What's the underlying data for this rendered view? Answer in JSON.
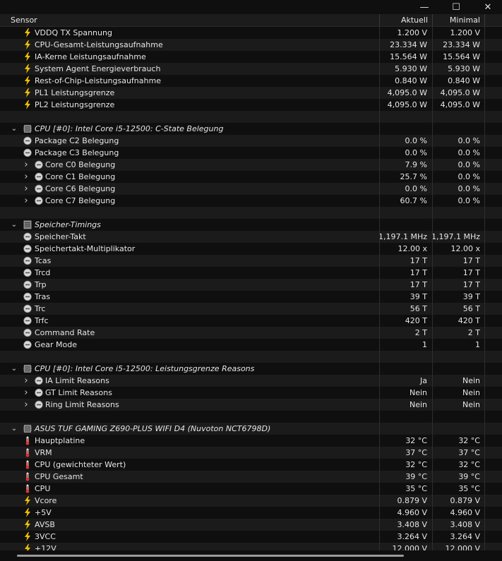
{
  "header": {
    "sensor": "Sensor",
    "current": "Aktuell",
    "minimal": "Minimal"
  },
  "window": {
    "minimize": "—",
    "maximize": "☐",
    "close": "✕"
  },
  "rows": [
    {
      "type": "item",
      "indent": 1,
      "icon": "bolt",
      "label": "VDDQ TX Spannung",
      "v1": "1.200 V",
      "v2": "1.200 V"
    },
    {
      "type": "item",
      "indent": 1,
      "icon": "bolt",
      "label": "CPU-Gesamt-Leistungsaufnahme",
      "v1": "23.334 W",
      "v2": "23.334 W"
    },
    {
      "type": "item",
      "indent": 1,
      "icon": "bolt",
      "label": "IA-Kerne Leistungsaufnahme",
      "v1": "15.564 W",
      "v2": "15.564 W"
    },
    {
      "type": "item",
      "indent": 1,
      "icon": "bolt",
      "label": "System Agent Energieverbrauch",
      "v1": "5.930 W",
      "v2": "5.930 W"
    },
    {
      "type": "item",
      "indent": 1,
      "icon": "bolt",
      "label": "Rest-of-Chip-Leistungsaufnahme",
      "v1": "0.840 W",
      "v2": "0.840 W"
    },
    {
      "type": "item",
      "indent": 1,
      "icon": "bolt",
      "label": "PL1 Leistungsgrenze",
      "v1": "4,095.0 W",
      "v2": "4,095.0 W"
    },
    {
      "type": "item",
      "indent": 1,
      "icon": "bolt",
      "label": "PL2 Leistungsgrenze",
      "v1": "4,095.0 W",
      "v2": "4,095.0 W"
    },
    {
      "type": "blank"
    },
    {
      "type": "group",
      "icon": "chip",
      "label": "CPU [#0]: Intel Core i5-12500: C-State Belegung"
    },
    {
      "type": "item",
      "indent": 1,
      "icon": "gauge",
      "label": "Package C2 Belegung",
      "v1": "0.0 %",
      "v2": "0.0 %"
    },
    {
      "type": "item",
      "indent": 1,
      "icon": "gauge",
      "label": "Package C3 Belegung",
      "v1": "0.0 %",
      "v2": "0.0 %"
    },
    {
      "type": "item",
      "indent": 2,
      "expand": true,
      "icon": "gauge",
      "label": "Core C0 Belegung",
      "v1": "7.9 %",
      "v2": "0.0 %"
    },
    {
      "type": "item",
      "indent": 2,
      "expand": true,
      "icon": "gauge",
      "label": "Core C1 Belegung",
      "v1": "25.7 %",
      "v2": "0.0 %"
    },
    {
      "type": "item",
      "indent": 2,
      "expand": true,
      "icon": "gauge",
      "label": "Core C6 Belegung",
      "v1": "0.0 %",
      "v2": "0.0 %"
    },
    {
      "type": "item",
      "indent": 2,
      "expand": true,
      "icon": "gauge",
      "label": "Core C7 Belegung",
      "v1": "60.7 %",
      "v2": "0.0 %"
    },
    {
      "type": "blank"
    },
    {
      "type": "group",
      "icon": "ram",
      "label": "Speicher-Timings"
    },
    {
      "type": "item",
      "indent": 1,
      "icon": "gauge",
      "label": "Speicher-Takt",
      "v1": "1,197.1 MHz",
      "v2": "1,197.1 MHz"
    },
    {
      "type": "item",
      "indent": 1,
      "icon": "gauge",
      "label": "Speichertakt-Multiplikator",
      "v1": "12.00 x",
      "v2": "12.00 x"
    },
    {
      "type": "item",
      "indent": 1,
      "icon": "gauge",
      "label": "Tcas",
      "v1": "17 T",
      "v2": "17 T"
    },
    {
      "type": "item",
      "indent": 1,
      "icon": "gauge",
      "label": "Trcd",
      "v1": "17 T",
      "v2": "17 T"
    },
    {
      "type": "item",
      "indent": 1,
      "icon": "gauge",
      "label": "Trp",
      "v1": "17 T",
      "v2": "17 T"
    },
    {
      "type": "item",
      "indent": 1,
      "icon": "gauge",
      "label": "Tras",
      "v1": "39 T",
      "v2": "39 T"
    },
    {
      "type": "item",
      "indent": 1,
      "icon": "gauge",
      "label": "Trc",
      "v1": "56 T",
      "v2": "56 T"
    },
    {
      "type": "item",
      "indent": 1,
      "icon": "gauge",
      "label": "Trfc",
      "v1": "420 T",
      "v2": "420 T"
    },
    {
      "type": "item",
      "indent": 1,
      "icon": "gauge",
      "label": "Command Rate",
      "v1": "2 T",
      "v2": "2 T"
    },
    {
      "type": "item",
      "indent": 1,
      "icon": "gauge",
      "label": "Gear Mode",
      "v1": "1",
      "v2": "1"
    },
    {
      "type": "blank"
    },
    {
      "type": "group",
      "icon": "chip",
      "label": "CPU [#0]: Intel Core i5-12500: Leistungsgrenze Reasons"
    },
    {
      "type": "item",
      "indent": 2,
      "expand": true,
      "icon": "gauge",
      "label": "IA Limit Reasons",
      "v1": "Ja",
      "v2": "Nein"
    },
    {
      "type": "item",
      "indent": 2,
      "expand": true,
      "icon": "gauge",
      "label": "GT Limit Reasons",
      "v1": "Nein",
      "v2": "Nein"
    },
    {
      "type": "item",
      "indent": 2,
      "expand": true,
      "icon": "gauge",
      "label": "Ring Limit Reasons",
      "v1": "Nein",
      "v2": "Nein"
    },
    {
      "type": "blank"
    },
    {
      "type": "group",
      "icon": "chip",
      "label": "ASUS TUF GAMING Z690-PLUS WIFI D4 (Nuvoton NCT6798D)"
    },
    {
      "type": "item",
      "indent": 1,
      "icon": "thermo",
      "label": "Hauptplatine",
      "v1": "32 °C",
      "v2": "32 °C"
    },
    {
      "type": "item",
      "indent": 1,
      "icon": "thermo",
      "label": "VRM",
      "v1": "37 °C",
      "v2": "37 °C"
    },
    {
      "type": "item",
      "indent": 1,
      "icon": "thermo",
      "label": "CPU (gewichteter Wert)",
      "v1": "32 °C",
      "v2": "32 °C"
    },
    {
      "type": "item",
      "indent": 1,
      "icon": "thermo",
      "label": "CPU Gesamt",
      "v1": "39 °C",
      "v2": "39 °C"
    },
    {
      "type": "item",
      "indent": 1,
      "icon": "thermo",
      "label": "CPU",
      "v1": "35 °C",
      "v2": "35 °C"
    },
    {
      "type": "item",
      "indent": 1,
      "icon": "bolt",
      "label": "Vcore",
      "v1": "0.879 V",
      "v2": "0.879 V"
    },
    {
      "type": "item",
      "indent": 1,
      "icon": "bolt",
      "label": "+5V",
      "v1": "4.960 V",
      "v2": "4.960 V"
    },
    {
      "type": "item",
      "indent": 1,
      "icon": "bolt",
      "label": "AVSB",
      "v1": "3.408 V",
      "v2": "3.408 V"
    },
    {
      "type": "item",
      "indent": 1,
      "icon": "bolt",
      "label": "3VCC",
      "v1": "3.264 V",
      "v2": "3.264 V"
    },
    {
      "type": "item",
      "indent": 1,
      "icon": "bolt",
      "label": "+12V",
      "v1": "12.000 V",
      "v2": "12.000 V"
    }
  ]
}
